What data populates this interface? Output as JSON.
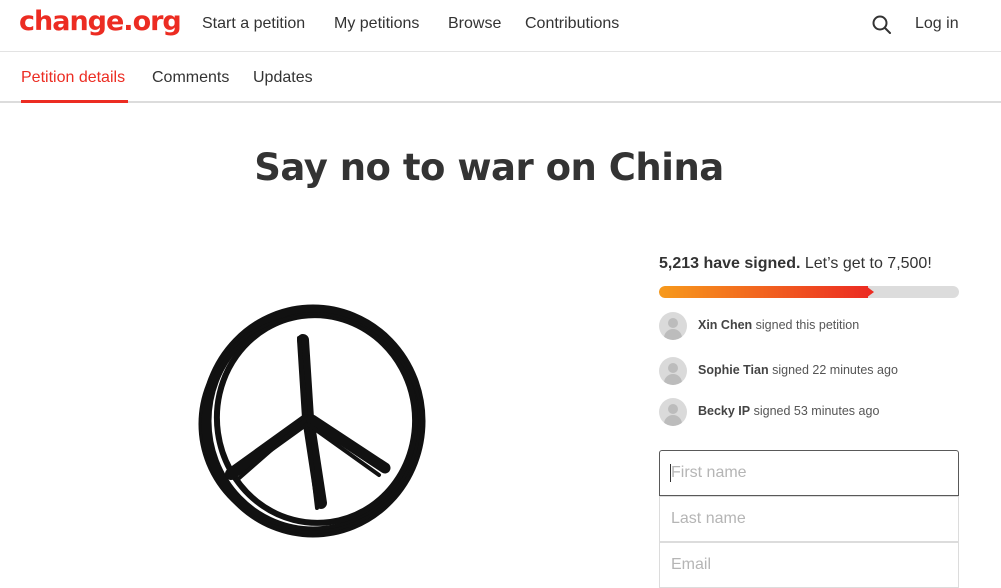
{
  "header": {
    "logo": "change.org",
    "nav": [
      "Start a petition",
      "My petitions",
      "Browse",
      "Contributions"
    ],
    "search_icon": "search-icon",
    "login": "Log in"
  },
  "tabs": [
    {
      "label": "Petition details",
      "active": true
    },
    {
      "label": "Comments",
      "active": false
    },
    {
      "label": "Updates",
      "active": false
    }
  ],
  "petition": {
    "title": "Say no to war on China",
    "image": "peace-symbol-drawing"
  },
  "signatures": {
    "count_text": "5,213 have signed.",
    "goal_text": "Let’s get to 7,500!",
    "progress_fraction": 0.695,
    "progress_colors": [
      "#f79a1c",
      "#ec2c22"
    ]
  },
  "recent_signers": [
    {
      "name": "Xin Chen",
      "action": "signed this petition"
    },
    {
      "name": "Sophie Tian",
      "action": "signed 22 minutes ago"
    },
    {
      "name": "Becky IP",
      "action": "signed 53 minutes ago"
    }
  ],
  "form": {
    "first_name_placeholder": "First name",
    "last_name_placeholder": "Last name",
    "email_placeholder": "Email"
  },
  "colors": {
    "brand": "#ec2c22",
    "text": "#333333"
  }
}
